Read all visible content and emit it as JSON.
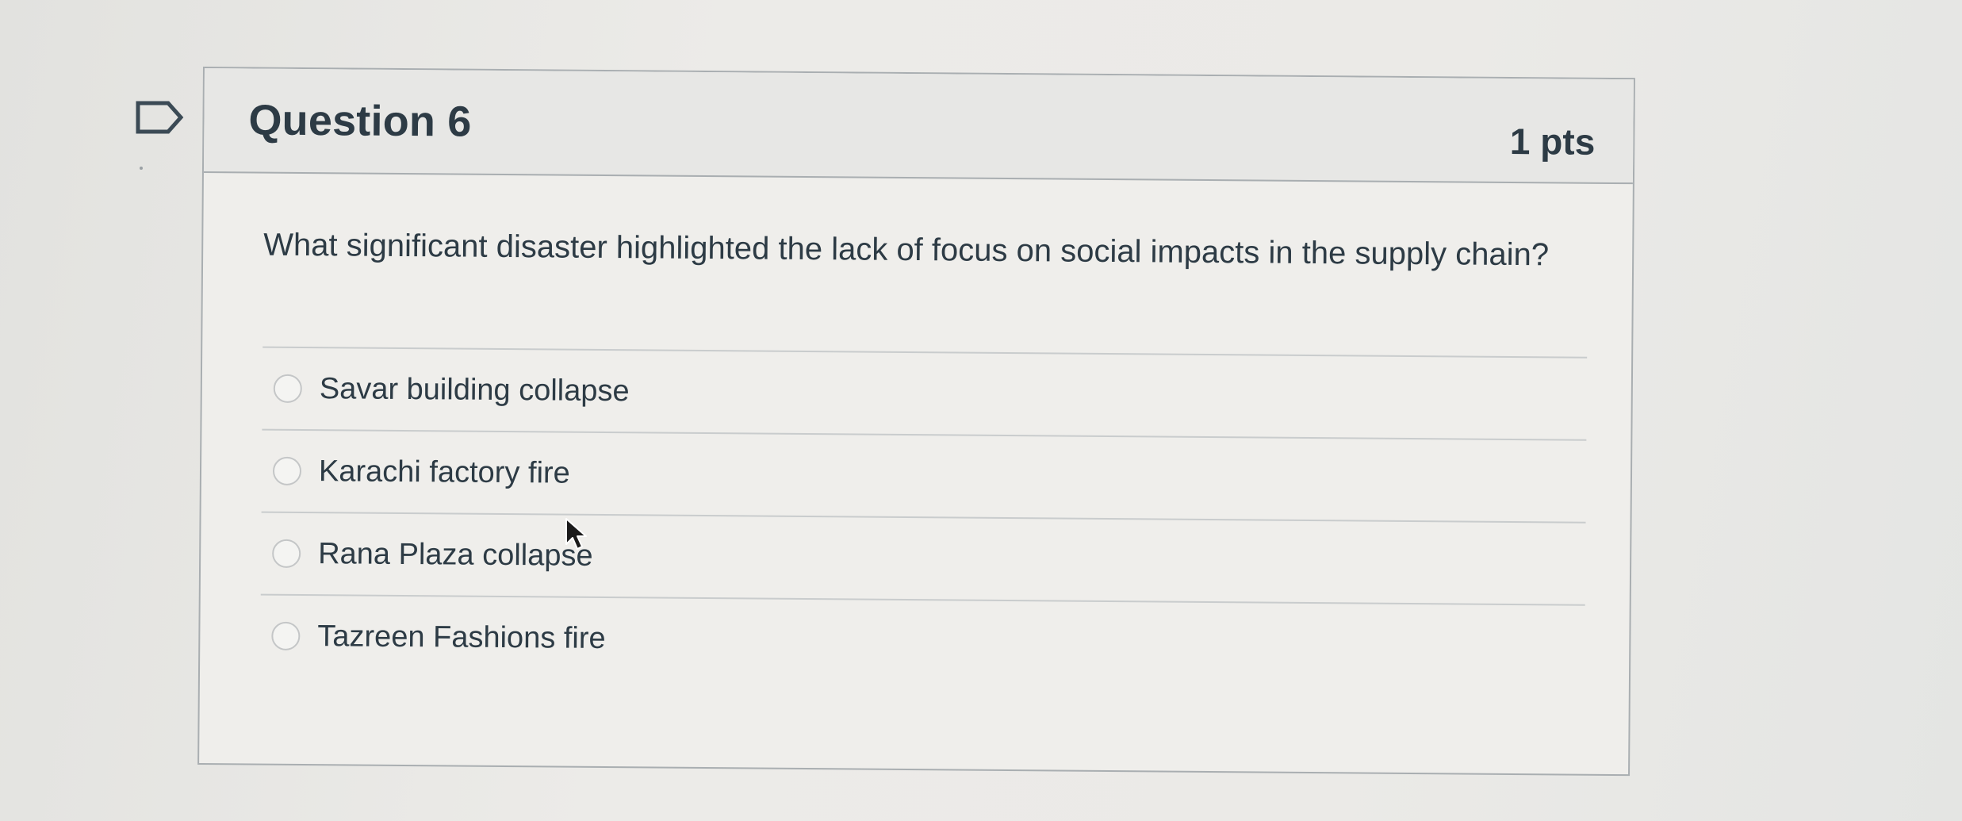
{
  "question": {
    "title": "Question 6",
    "points": "1 pts",
    "text": "What significant disaster highlighted the lack of focus on social impacts in the supply chain?",
    "answers": [
      {
        "label": "Savar building collapse",
        "selected": false
      },
      {
        "label": "Karachi factory fire",
        "selected": false
      },
      {
        "label": "Rana Plaza collapse",
        "selected": false
      },
      {
        "label": "Tazreen Fashions fire",
        "selected": false
      }
    ]
  },
  "icons": {
    "flag": "flag-question-icon",
    "cursor": "mouse-pointer-icon"
  },
  "colors": {
    "text": "#2d3b45",
    "border": "#a9aeb1",
    "header_bg": "#e7e7e5",
    "card_bg": "#efeeeb",
    "flag_stroke": "#3b4a55"
  }
}
